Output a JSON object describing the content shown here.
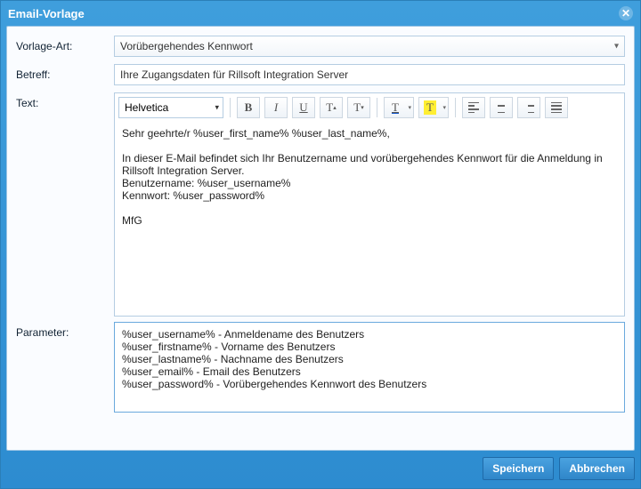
{
  "window": {
    "title": "Email-Vorlage"
  },
  "labels": {
    "templateType": "Vorlage-Art:",
    "subject": "Betreff:",
    "text": "Text:",
    "parameter": "Parameter:"
  },
  "fields": {
    "templateType": "Vorübergehendes Kennwort",
    "subject": "Ihre Zugangsdaten für Rillsoft Integration Server"
  },
  "editor": {
    "font": "Helvetica",
    "body": "Sehr geehrte/r %user_first_name% %user_last_name%,\n\nIn dieser E-Mail befindet sich Ihr Benutzername und vorübergehendes Kennwort für die Anmeldung in Rillsoft Integration Server.\nBenutzername: %user_username%\nKennwort: %user_password%\n\nMfG"
  },
  "parameters": "%user_username% - Anmeldename des Benutzers\n%user_firstname% - Vorname des Benutzers\n%user_lastname% - Nachname des Benutzers\n%user_email% - Email des Benutzers\n%user_password% - Vorübergehendes Kennwort des Benutzers",
  "toolbar": {
    "bold": "B",
    "italic": "I",
    "underline": "U",
    "tsup": "T",
    "tsub": "T",
    "fg": "T",
    "hl": "T"
  },
  "footer": {
    "save": "Speichern",
    "cancel": "Abbrechen"
  }
}
